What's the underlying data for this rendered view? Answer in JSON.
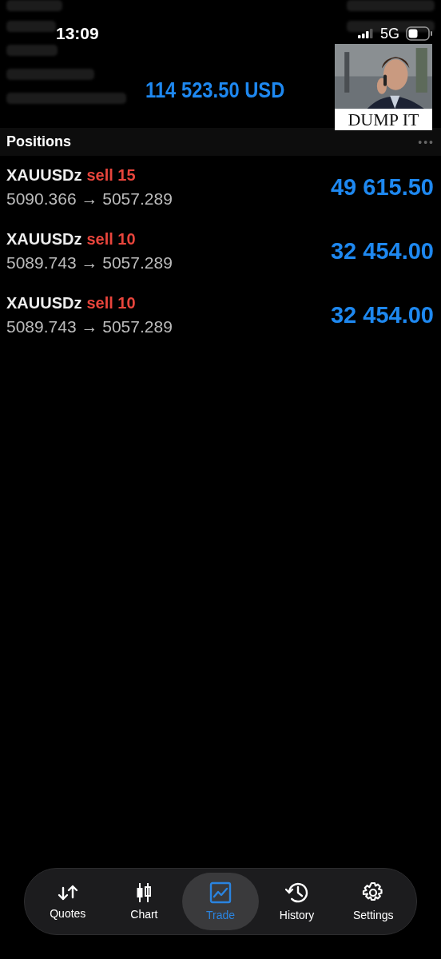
{
  "status_bar": {
    "time": "13:09",
    "network": "5G"
  },
  "account": {
    "total": "114 523.50 USD"
  },
  "overlay_image": {
    "caption": "DUMP IT"
  },
  "positions": {
    "title": "Positions",
    "more": "•••",
    "items": [
      {
        "symbol": "XAUUSDz",
        "side": "sell 15",
        "prices": "5090.366 → 5057.289",
        "profit": "49 615.50"
      },
      {
        "symbol": "XAUUSDz",
        "side": "sell 10",
        "prices": "5089.743 → 5057.289",
        "profit": "32 454.00"
      },
      {
        "symbol": "XAUUSDz",
        "side": "sell 10",
        "prices": "5089.743 → 5057.289",
        "profit": "32 454.00"
      }
    ]
  },
  "tabs": [
    {
      "label": "Quotes",
      "selected": false
    },
    {
      "label": "Chart",
      "selected": false
    },
    {
      "label": "Trade",
      "selected": true
    },
    {
      "label": "History",
      "selected": false
    },
    {
      "label": "Settings",
      "selected": false
    }
  ]
}
